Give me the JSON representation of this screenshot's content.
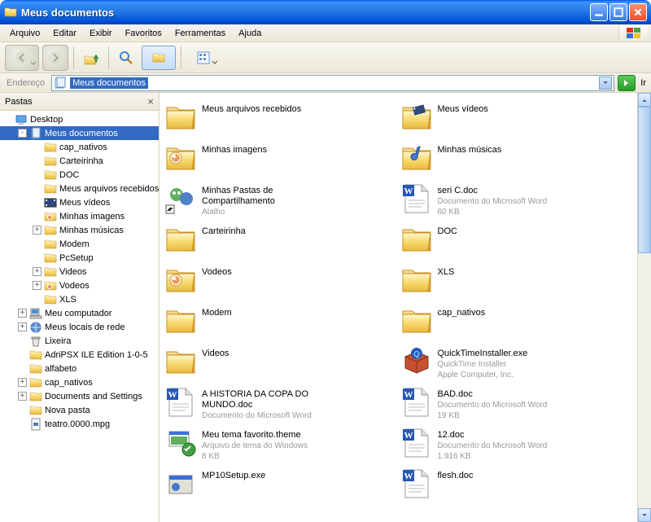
{
  "window": {
    "title": "Meus documentos"
  },
  "menu": {
    "arquivo": "Arquivo",
    "editar": "Editar",
    "exibir": "Exibir",
    "favoritos": "Favoritos",
    "ferramentas": "Ferramentas",
    "ajuda": "Ajuda"
  },
  "address": {
    "label": "Endereço",
    "value": "Meus documentos",
    "go": "Ir"
  },
  "tree": {
    "header": "Pastas",
    "nodes": [
      {
        "indent": 0,
        "twist": "",
        "icon": "desktop",
        "label": "Desktop"
      },
      {
        "indent": 1,
        "twist": "-",
        "icon": "mydocs",
        "label": "Meus documentos",
        "selected": true
      },
      {
        "indent": 2,
        "twist": "",
        "icon": "folder",
        "label": "cap_nativos"
      },
      {
        "indent": 2,
        "twist": "",
        "icon": "folder",
        "label": "Carteirinha"
      },
      {
        "indent": 2,
        "twist": "",
        "icon": "folder",
        "label": "DOC"
      },
      {
        "indent": 2,
        "twist": "",
        "icon": "folder",
        "label": "Meus arquivos recebidos"
      },
      {
        "indent": 2,
        "twist": "",
        "icon": "videos",
        "label": "Meus vídeos"
      },
      {
        "indent": 2,
        "twist": "",
        "icon": "images",
        "label": "Minhas imagens"
      },
      {
        "indent": 2,
        "twist": "+",
        "icon": "music",
        "label": "Minhas músicas"
      },
      {
        "indent": 2,
        "twist": "",
        "icon": "folder",
        "label": "Modem"
      },
      {
        "indent": 2,
        "twist": "",
        "icon": "folder",
        "label": "PcSetup"
      },
      {
        "indent": 2,
        "twist": "+",
        "icon": "folder",
        "label": "Videos"
      },
      {
        "indent": 2,
        "twist": "+",
        "icon": "images",
        "label": "Vodeos"
      },
      {
        "indent": 2,
        "twist": "",
        "icon": "folder",
        "label": "XLS"
      },
      {
        "indent": 1,
        "twist": "+",
        "icon": "computer",
        "label": "Meu computador"
      },
      {
        "indent": 1,
        "twist": "+",
        "icon": "network",
        "label": "Meus locais de rede"
      },
      {
        "indent": 1,
        "twist": "",
        "icon": "recycle",
        "label": "Lixeira"
      },
      {
        "indent": 1,
        "twist": "",
        "icon": "folder",
        "label": "AdriPSX ILE Edition 1-0-5"
      },
      {
        "indent": 1,
        "twist": "",
        "icon": "folder",
        "label": "alfabeto"
      },
      {
        "indent": 1,
        "twist": "+",
        "icon": "folder",
        "label": "cap_nativos"
      },
      {
        "indent": 1,
        "twist": "+",
        "icon": "folder",
        "label": "Documents and Settings"
      },
      {
        "indent": 1,
        "twist": "",
        "icon": "folder",
        "label": "Nova pasta"
      },
      {
        "indent": 1,
        "twist": "",
        "icon": "mpg",
        "label": "teatro.0000.mpg"
      }
    ]
  },
  "files": [
    {
      "icon": "folder-open",
      "name": "Meus arquivos recebidos",
      "sub1": "",
      "sub2": ""
    },
    {
      "icon": "folder-videos",
      "name": "Meus vídeos",
      "sub1": "",
      "sub2": ""
    },
    {
      "icon": "folder-images",
      "name": "Minhas imagens",
      "sub1": "",
      "sub2": ""
    },
    {
      "icon": "folder-music",
      "name": "Minhas músicas",
      "sub1": "",
      "sub2": ""
    },
    {
      "icon": "shortcut-share",
      "name": "Minhas Pastas de Compartilhamento",
      "sub1": "Atalho",
      "sub2": ""
    },
    {
      "icon": "word",
      "name": "seri C.doc",
      "sub1": "Documento do Microsoft Word",
      "sub2": "60 KB"
    },
    {
      "icon": "folder-open",
      "name": "Carteirinha",
      "sub1": "",
      "sub2": ""
    },
    {
      "icon": "folder-open",
      "name": "DOC",
      "sub1": "",
      "sub2": ""
    },
    {
      "icon": "folder-images",
      "name": "Vodeos",
      "sub1": "",
      "sub2": ""
    },
    {
      "icon": "folder-open",
      "name": "XLS",
      "sub1": "",
      "sub2": ""
    },
    {
      "icon": "folder-open",
      "name": "Modem",
      "sub1": "",
      "sub2": ""
    },
    {
      "icon": "folder-open",
      "name": "cap_nativos",
      "sub1": "",
      "sub2": ""
    },
    {
      "icon": "folder-open",
      "name": "Videos",
      "sub1": "",
      "sub2": ""
    },
    {
      "icon": "installer-qt",
      "name": "QuickTimeInstaller.exe",
      "sub1": "QuickTime Installer",
      "sub2": "Apple Computer, Inc."
    },
    {
      "icon": "word",
      "name": "A HISTORIA DA COPA DO MUNDO.doc",
      "sub1": "Documento do Microsoft Word",
      "sub2": ""
    },
    {
      "icon": "word",
      "name": "BAD.doc",
      "sub1": "Documento do Microsoft Word",
      "sub2": "19 KB"
    },
    {
      "icon": "theme",
      "name": "Meu tema favorito.theme",
      "sub1": "Arquivo de tema do Windows",
      "sub2": "8 KB"
    },
    {
      "icon": "word",
      "name": "12.doc",
      "sub1": "Documento do Microsoft Word",
      "sub2": "1.916 KB"
    },
    {
      "icon": "installer",
      "name": "MP10Setup.exe",
      "sub1": "",
      "sub2": ""
    },
    {
      "icon": "word",
      "name": "flesh.doc",
      "sub1": "",
      "sub2": ""
    }
  ]
}
